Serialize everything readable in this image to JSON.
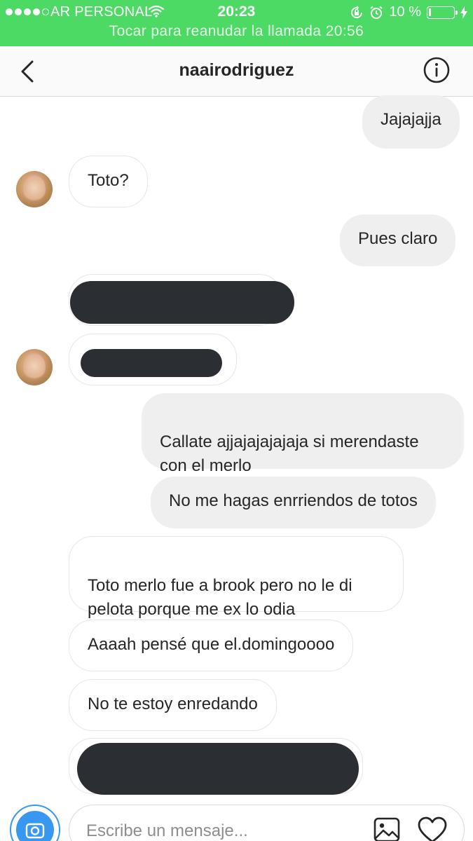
{
  "status_bar": {
    "carrier": "AR PERSONAL",
    "time": "20:23",
    "battery_text": "10 %",
    "battery_level": 0.1,
    "signal_bars": 4,
    "call_banner": "Tocar para reanudar la llamada 20:56",
    "background_color": "#4cd964"
  },
  "header": {
    "title": "naairodriguez",
    "back_icon": "chevron-left-icon",
    "info_icon": "info-icon"
  },
  "messages": [
    {
      "side": "out",
      "text": "Jajajajja"
    },
    {
      "side": "in",
      "text": "Toto?",
      "avatar": true
    },
    {
      "side": "out",
      "text": "Pues claro"
    },
    {
      "side": "in",
      "text": "",
      "redacted": true
    },
    {
      "side": "in",
      "text": "",
      "redacted": true,
      "avatar": true
    },
    {
      "side": "out",
      "text": "Callate ajjajajajajaja si merendaste\ncon el merlo"
    },
    {
      "side": "out",
      "text": "No me hagas enrriendos de totos"
    },
    {
      "side": "in",
      "text": "Toto merlo fue a brook pero no le di\npelota porque me ex lo odia"
    },
    {
      "side": "in",
      "text": "Aaaah pensé que el.domingoooo"
    },
    {
      "side": "in",
      "text": "No te estoy enredando"
    },
    {
      "side": "in",
      "text": "",
      "redacted": true
    }
  ],
  "composer": {
    "placeholder": "Escribe un mensaje...",
    "camera_icon": "camera-icon",
    "gallery_icon": "image-icon",
    "like_icon": "heart-icon",
    "accent_color": "#3897f0"
  }
}
